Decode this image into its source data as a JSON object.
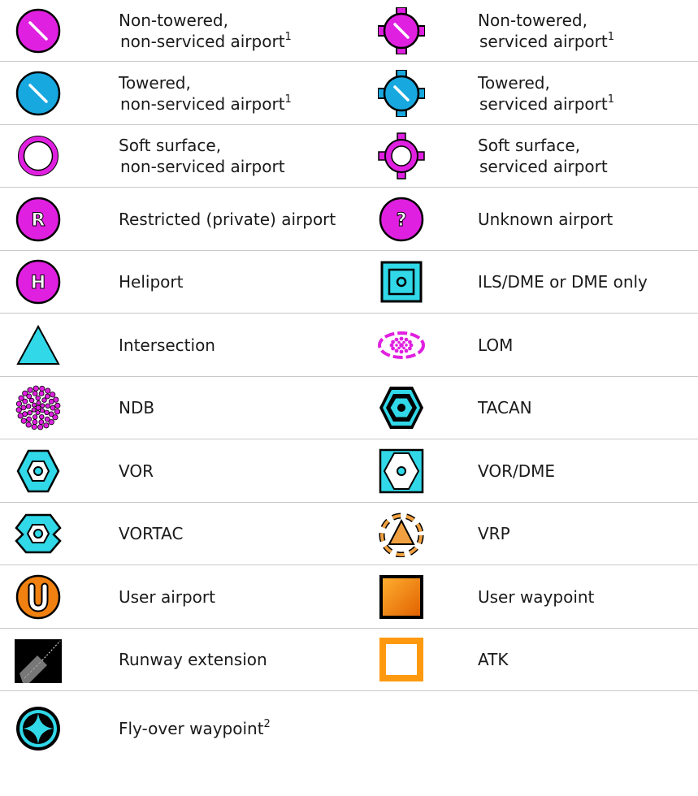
{
  "rows": [
    {
      "left": {
        "line1": "Non-towered,",
        "line2": "non-serviced airport",
        "sup": "1",
        "icon": "non-towered-non-serviced-airport-icon"
      },
      "right": {
        "line1": "Non-towered,",
        "line2": "serviced airport",
        "sup": "1",
        "icon": "non-towered-serviced-airport-icon"
      }
    },
    {
      "left": {
        "line1": "Towered,",
        "line2": "non-serviced airport",
        "sup": "1",
        "icon": "towered-non-serviced-airport-icon"
      },
      "right": {
        "line1": "Towered,",
        "line2": "serviced airport",
        "sup": "1",
        "icon": "towered-serviced-airport-icon"
      }
    },
    {
      "left": {
        "line1": "Soft surface,",
        "line2": "non-serviced airport",
        "icon": "soft-surface-non-serviced-airport-icon"
      },
      "right": {
        "line1": "Soft surface,",
        "line2": "serviced airport",
        "icon": "soft-surface-serviced-airport-icon"
      }
    },
    {
      "left": {
        "line1": "Restricted (private) airport",
        "icon": "restricted-airport-icon",
        "glyph": "R"
      },
      "right": {
        "line1": "Unknown airport",
        "icon": "unknown-airport-icon",
        "glyph": "?"
      }
    },
    {
      "left": {
        "line1": "Heliport",
        "icon": "heliport-icon",
        "glyph": "H"
      },
      "right": {
        "line1": "ILS/DME or DME only",
        "icon": "ils-dme-icon"
      }
    },
    {
      "left": {
        "line1": "Intersection",
        "icon": "intersection-icon"
      },
      "right": {
        "line1": "LOM",
        "icon": "lom-icon"
      }
    },
    {
      "left": {
        "line1": "NDB",
        "icon": "ndb-icon"
      },
      "right": {
        "line1": "TACAN",
        "icon": "tacan-icon"
      }
    },
    {
      "left": {
        "line1": "VOR",
        "icon": "vor-icon"
      },
      "right": {
        "line1": "VOR/DME",
        "icon": "vor-dme-icon"
      }
    },
    {
      "left": {
        "line1": "VORTAC",
        "icon": "vortac-icon"
      },
      "right": {
        "line1": "VRP",
        "icon": "vrp-icon"
      }
    },
    {
      "left": {
        "line1": "User airport",
        "icon": "user-airport-icon",
        "glyph": "U"
      },
      "right": {
        "line1": "User waypoint",
        "icon": "user-waypoint-icon"
      }
    },
    {
      "left": {
        "line1": "Runway extension",
        "icon": "runway-extension-icon"
      },
      "right": {
        "line1": "ATK",
        "icon": "atk-icon"
      }
    },
    {
      "left": {
        "line1": "Fly-over waypoint",
        "sup": "2",
        "icon": "fly-over-waypoint-icon"
      },
      "right": null
    }
  ],
  "colors": {
    "magenta": "#e020e0",
    "cyan": "#18a8e0",
    "aqua": "#30d8e8",
    "orange": "#f08010",
    "vrp_orange": "#f0a040",
    "atk_orange": "#ff9a10",
    "black": "#000000"
  }
}
